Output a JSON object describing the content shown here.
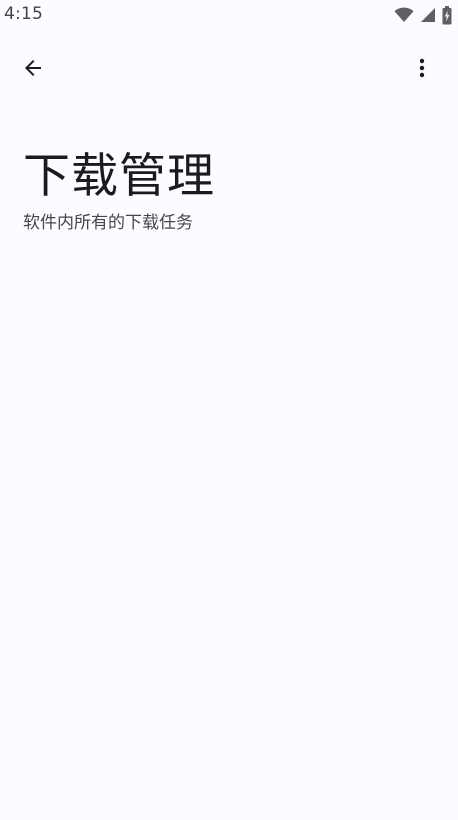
{
  "status_bar": {
    "time": "4:15",
    "icons": [
      "wifi-icon",
      "signal-icon",
      "battery-charging-icon"
    ]
  },
  "app_bar": {
    "back_icon": "arrow-back-icon",
    "more_icon": "more-vert-icon"
  },
  "header": {
    "title": "下载管理",
    "subtitle": "软件内所有的下载任务"
  },
  "colors": {
    "background": "#fdfbff",
    "text_primary": "#1b1b1f",
    "text_secondary": "#45464f",
    "status_icons": "#5f5f66"
  }
}
